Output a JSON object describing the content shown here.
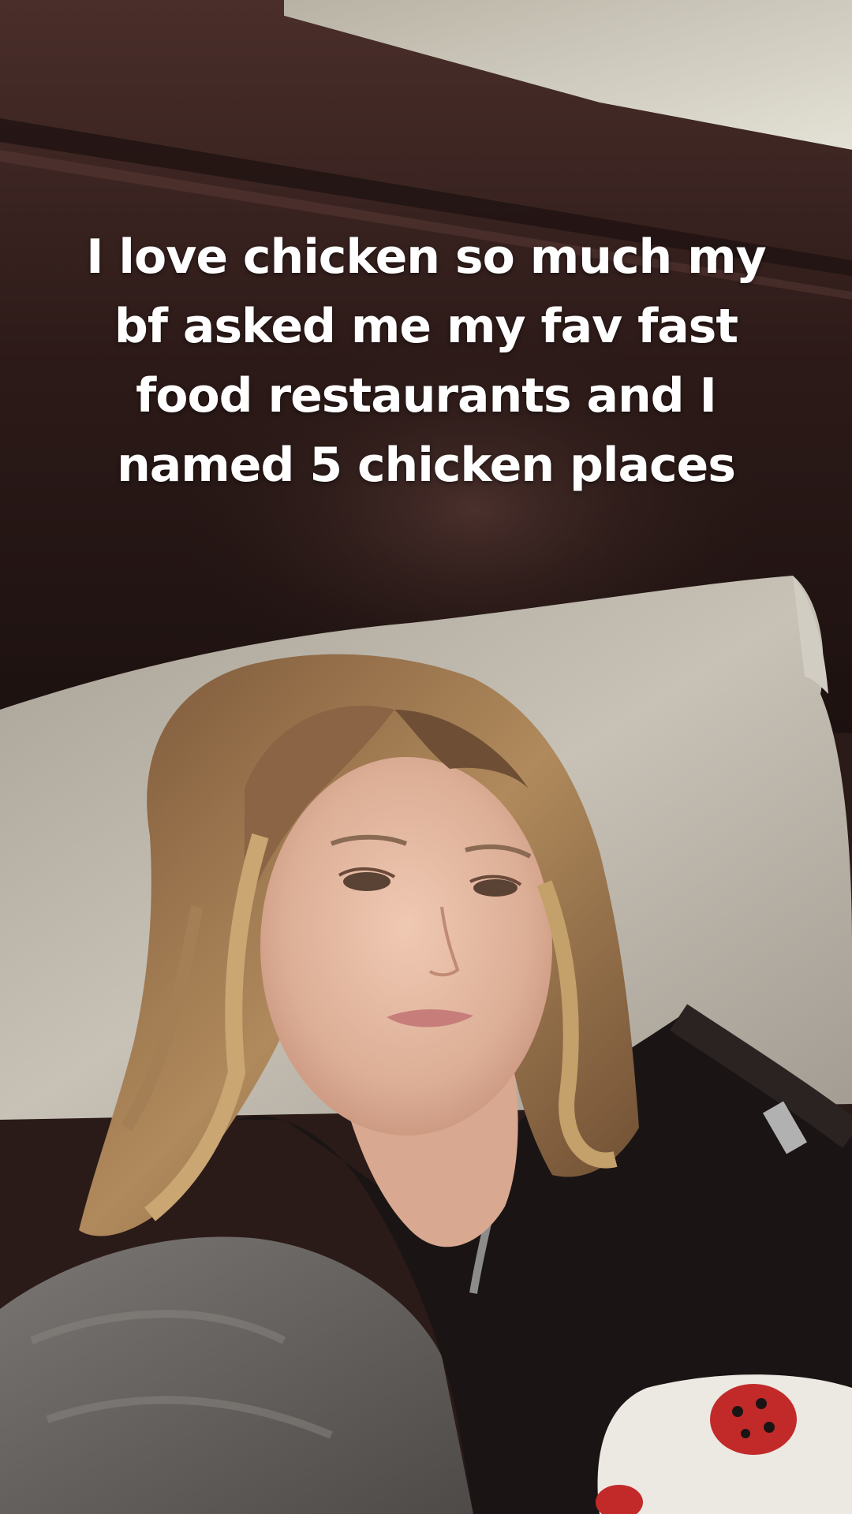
{
  "caption": {
    "lines": [
      "I love chicken so much my",
      "bf asked me my fav fast",
      "food restaurants and I",
      "named 5 chicken places"
    ]
  },
  "colors": {
    "wall_top": "#d8d5c8",
    "headboard": "#3a2220",
    "pillow": "#b9b3a8",
    "skin": "#e0b39c",
    "hair": "#9a7150",
    "robe": "#1a1514",
    "blanket": "#6b6764",
    "plush": "#ece8e2",
    "ladybug": "#c22a2a"
  }
}
